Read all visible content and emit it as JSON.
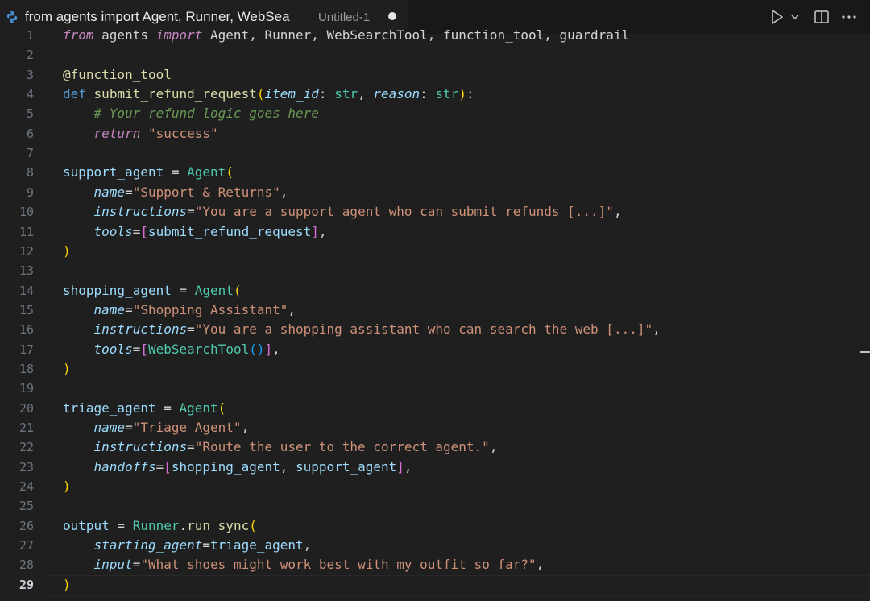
{
  "tab": {
    "title": "from agents import Agent, Runner, WebSea",
    "description": "Untitled-1",
    "dirty": true,
    "language_icon": "python-icon"
  },
  "toolbar": {
    "run_icon": "play-icon",
    "run_menu_icon": "chevron-down-icon",
    "split_icon": "split-editor-icon",
    "more_icon": "more-actions-icon"
  },
  "editor": {
    "active_line": 29,
    "lines": [
      {
        "n": "1",
        "tokens": [
          [
            "ctl",
            "from"
          ],
          [
            "plain",
            " agents "
          ],
          [
            "ctl",
            "import"
          ],
          [
            "plain",
            " Agent, Runner, WebSearchTool, function_tool, guardrail"
          ]
        ]
      },
      {
        "n": "2",
        "tokens": []
      },
      {
        "n": "3",
        "tokens": [
          [
            "dec",
            "@function_tool"
          ]
        ]
      },
      {
        "n": "4",
        "tokens": [
          [
            "kw",
            "def"
          ],
          [
            "plain",
            " "
          ],
          [
            "fn",
            "submit_refund_request"
          ],
          [
            "p1",
            "("
          ],
          [
            "param",
            "item_id"
          ],
          [
            "plain",
            ": "
          ],
          [
            "cls",
            "str"
          ],
          [
            "plain",
            ", "
          ],
          [
            "param",
            "reason"
          ],
          [
            "plain",
            ": "
          ],
          [
            "cls",
            "str"
          ],
          [
            "p1",
            ")"
          ],
          [
            "plain",
            ":"
          ]
        ]
      },
      {
        "n": "5",
        "tokens": [
          [
            "plain",
            "    "
          ],
          [
            "cmt",
            "# Your refund logic goes here"
          ]
        ]
      },
      {
        "n": "6",
        "tokens": [
          [
            "plain",
            "    "
          ],
          [
            "ctl",
            "return"
          ],
          [
            "plain",
            " "
          ],
          [
            "str",
            "\"success\""
          ]
        ]
      },
      {
        "n": "7",
        "tokens": []
      },
      {
        "n": "8",
        "tokens": [
          [
            "var",
            "support_agent"
          ],
          [
            "plain",
            " = "
          ],
          [
            "cls",
            "Agent"
          ],
          [
            "p1",
            "("
          ]
        ]
      },
      {
        "n": "9",
        "tokens": [
          [
            "plain",
            "    "
          ],
          [
            "kwarg",
            "name"
          ],
          [
            "plain",
            "="
          ],
          [
            "str",
            "\"Support & Returns\""
          ],
          [
            "plain",
            ","
          ]
        ]
      },
      {
        "n": "10",
        "tokens": [
          [
            "plain",
            "    "
          ],
          [
            "kwarg",
            "instructions"
          ],
          [
            "plain",
            "="
          ],
          [
            "str",
            "\"You are a support agent who can submit refunds [...]\""
          ],
          [
            "plain",
            ","
          ]
        ]
      },
      {
        "n": "11",
        "tokens": [
          [
            "plain",
            "    "
          ],
          [
            "kwarg",
            "tools"
          ],
          [
            "plain",
            "="
          ],
          [
            "p2",
            "["
          ],
          [
            "var",
            "submit_refund_request"
          ],
          [
            "p2",
            "]"
          ],
          [
            "plain",
            ","
          ]
        ]
      },
      {
        "n": "12",
        "tokens": [
          [
            "p1",
            ")"
          ]
        ]
      },
      {
        "n": "13",
        "tokens": []
      },
      {
        "n": "14",
        "tokens": [
          [
            "var",
            "shopping_agent"
          ],
          [
            "plain",
            " = "
          ],
          [
            "cls",
            "Agent"
          ],
          [
            "p1",
            "("
          ]
        ]
      },
      {
        "n": "15",
        "tokens": [
          [
            "plain",
            "    "
          ],
          [
            "kwarg",
            "name"
          ],
          [
            "plain",
            "="
          ],
          [
            "str",
            "\"Shopping Assistant\""
          ],
          [
            "plain",
            ","
          ]
        ]
      },
      {
        "n": "16",
        "tokens": [
          [
            "plain",
            "    "
          ],
          [
            "kwarg",
            "instructions"
          ],
          [
            "plain",
            "="
          ],
          [
            "str",
            "\"You are a shopping assistant who can search the web [...]\""
          ],
          [
            "plain",
            ","
          ]
        ]
      },
      {
        "n": "17",
        "tokens": [
          [
            "plain",
            "    "
          ],
          [
            "kwarg",
            "tools"
          ],
          [
            "plain",
            "="
          ],
          [
            "p2",
            "["
          ],
          [
            "cls",
            "WebSearchTool"
          ],
          [
            "p3",
            "()"
          ],
          [
            "p2",
            "]"
          ],
          [
            "plain",
            ","
          ]
        ]
      },
      {
        "n": "18",
        "tokens": [
          [
            "p1",
            ")"
          ]
        ]
      },
      {
        "n": "19",
        "tokens": []
      },
      {
        "n": "20",
        "tokens": [
          [
            "var",
            "triage_agent"
          ],
          [
            "plain",
            " = "
          ],
          [
            "cls",
            "Agent"
          ],
          [
            "p1",
            "("
          ]
        ]
      },
      {
        "n": "21",
        "tokens": [
          [
            "plain",
            "    "
          ],
          [
            "kwarg",
            "name"
          ],
          [
            "plain",
            "="
          ],
          [
            "str",
            "\"Triage Agent\""
          ],
          [
            "plain",
            ","
          ]
        ]
      },
      {
        "n": "22",
        "tokens": [
          [
            "plain",
            "    "
          ],
          [
            "kwarg",
            "instructions"
          ],
          [
            "plain",
            "="
          ],
          [
            "str",
            "\"Route the user to the correct agent.\""
          ],
          [
            "plain",
            ","
          ]
        ]
      },
      {
        "n": "23",
        "tokens": [
          [
            "plain",
            "    "
          ],
          [
            "kwarg",
            "handoffs"
          ],
          [
            "plain",
            "="
          ],
          [
            "p2",
            "["
          ],
          [
            "var",
            "shopping_agent"
          ],
          [
            "plain",
            ", "
          ],
          [
            "var",
            "support_agent"
          ],
          [
            "p2",
            "]"
          ],
          [
            "plain",
            ","
          ]
        ]
      },
      {
        "n": "24",
        "tokens": [
          [
            "p1",
            ")"
          ]
        ]
      },
      {
        "n": "25",
        "tokens": []
      },
      {
        "n": "26",
        "tokens": [
          [
            "var",
            "output"
          ],
          [
            "plain",
            " = "
          ],
          [
            "cls",
            "Runner"
          ],
          [
            "plain",
            "."
          ],
          [
            "fn",
            "run_sync"
          ],
          [
            "p1",
            "("
          ]
        ]
      },
      {
        "n": "27",
        "tokens": [
          [
            "plain",
            "    "
          ],
          [
            "kwarg",
            "starting_agent"
          ],
          [
            "plain",
            "="
          ],
          [
            "var",
            "triage_agent"
          ],
          [
            "plain",
            ","
          ]
        ]
      },
      {
        "n": "28",
        "tokens": [
          [
            "plain",
            "    "
          ],
          [
            "kwarg",
            "input"
          ],
          [
            "plain",
            "="
          ],
          [
            "str",
            "\"What shoes might work best with my outfit so far?\""
          ],
          [
            "plain",
            ","
          ]
        ]
      },
      {
        "n": "29",
        "tokens": [
          [
            "p1",
            ")"
          ]
        ]
      }
    ]
  }
}
